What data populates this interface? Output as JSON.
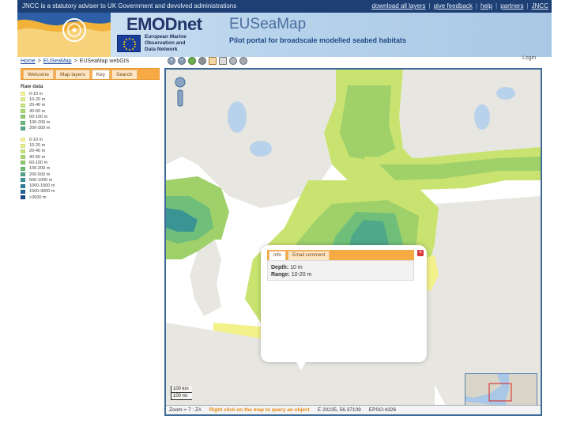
{
  "topbar": {
    "notice": "JNCC is a statutory adviser to UK Government and devolved administrations",
    "links": [
      "download all layers",
      "give feedback",
      "help",
      "partners",
      "JNCC"
    ],
    "separator": "|"
  },
  "banner": {
    "brand": "EMODnet",
    "brand_sub": [
      "European Marine",
      "Observation and",
      "Data Network"
    ],
    "site_title": "EUSeaMap",
    "tagline": "Pilot portal for broadscale modelled seabed habitats"
  },
  "breadcrumb": {
    "items": [
      "Home",
      "EUSeaMap",
      "EUSeaMap webGIS"
    ],
    "separator": ">"
  },
  "login_label": "Login",
  "left_tabs": [
    "Welcome",
    "Map layers",
    "Key",
    "Search"
  ],
  "active_left_tab": 2,
  "legend": {
    "title": "Raw data",
    "group1": [
      {
        "label": "0-10 m",
        "color": "#f6f39a"
      },
      {
        "label": "10-20 m",
        "color": "#e4ef8c"
      },
      {
        "label": "20-40 m",
        "color": "#c9e57f"
      },
      {
        "label": "40-60 m",
        "color": "#aed873"
      },
      {
        "label": "60-100 m",
        "color": "#8fca71"
      },
      {
        "label": "100-200 m",
        "color": "#6dba7a"
      },
      {
        "label": "200-300 m",
        "color": "#4fa88a"
      }
    ],
    "group2": [
      {
        "label": "0-10 m",
        "color": "#f6f39a"
      },
      {
        "label": "10-20 m",
        "color": "#e4ef8c"
      },
      {
        "label": "20-40 m",
        "color": "#c9e57f"
      },
      {
        "label": "40-60 m",
        "color": "#aed873"
      },
      {
        "label": "60-100 m",
        "color": "#8fca71"
      },
      {
        "label": "100-200 m",
        "color": "#6dba7a"
      },
      {
        "label": "200-500 m",
        "color": "#4fa88a"
      },
      {
        "label": "500-1000 m",
        "color": "#3b9494"
      },
      {
        "label": "1000-1500 m",
        "color": "#2f7f9a"
      },
      {
        "label": "1500-3000 m",
        "color": "#27659a"
      },
      {
        "label": ">3000 m",
        "color": "#1f4a8a"
      }
    ]
  },
  "popup": {
    "tabs": [
      "Info",
      "Email comment"
    ],
    "close": "×",
    "depth_label": "Depth:",
    "depth_value": "10 m",
    "range_label": "Range:",
    "range_value": "10-20 m"
  },
  "scale": {
    "km": "100 km",
    "mi": "100 mi"
  },
  "status": {
    "zoom_text": "Zoom = 7 : Z#",
    "hint": "Right click on the map to query an object",
    "coords": "E 20235, 56.37109",
    "epsg": "EPSG:4326"
  },
  "colors": {
    "water": "#ffffff",
    "land": "#e8e6e0",
    "shallow": "#f3f18a",
    "mid": "#c8e36f",
    "deep": "#9fd06a",
    "deeper": "#6fbf7a",
    "accent_tab": "#f7a944",
    "brand_blue": "#23356a"
  }
}
